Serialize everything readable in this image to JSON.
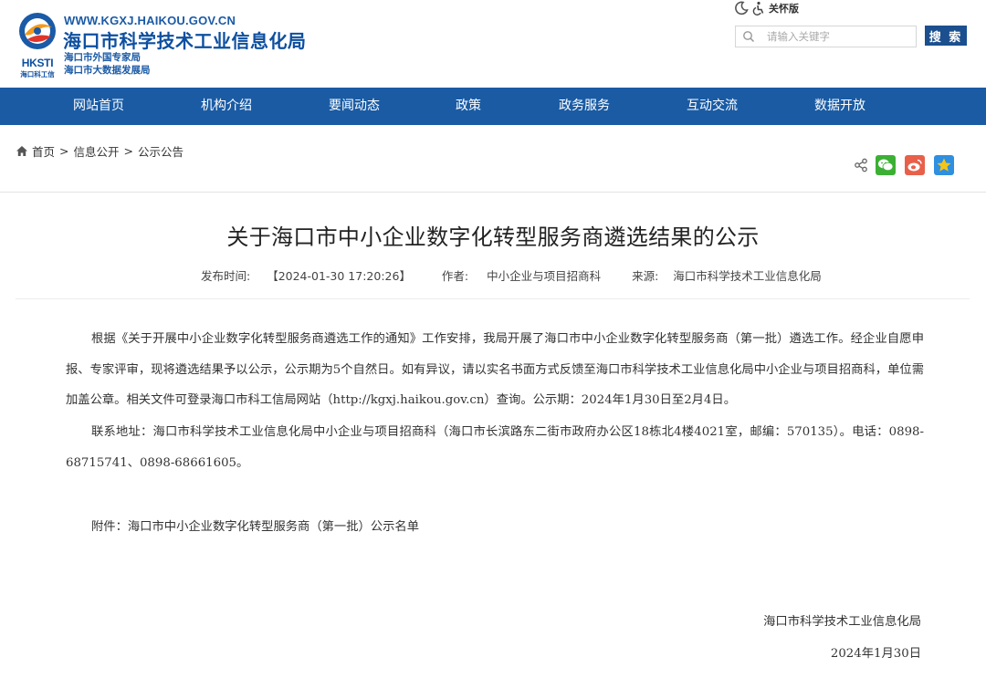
{
  "header": {
    "url": "WWW.KGXJ.HAIKOU.GOV.CN",
    "name": "海口市科学技术工业信息化局",
    "sub1": "海口市外国专家局",
    "sub2": "海口市大数据发展局",
    "logo_text": "HKSTI",
    "logo_sub": "海口科工信",
    "care_mode": "关怀版",
    "search_placeholder": "请输入关键字",
    "search_button": "搜 索"
  },
  "nav": {
    "items": [
      "网站首页",
      "机构介绍",
      "要闻动态",
      "政策",
      "政务服务",
      "互动交流",
      "数据开放"
    ]
  },
  "breadcrumb": {
    "items": [
      "首页",
      "信息公开",
      "公示公告"
    ],
    "separator": ">"
  },
  "article": {
    "title": "关于海口市中小企业数字化转型服务商遴选结果的公示",
    "meta": {
      "date_label": "发布时间:",
      "date_value": "【2024-01-30 17:20:26】",
      "author_label": "作者:",
      "author_value": "中小企业与项目招商科",
      "source_label": "来源:",
      "source_value": "海口市科学技术工业信息化局"
    },
    "p1": "根据《关于开展中小企业数字化转型服务商遴选工作的通知》工作安排，我局开展了海口市中小企业数字化转型服务商（第一批）遴选工作。经企业自愿申报、专家评审，现将遴选结果予以公示，公示期为5个自然日。如有异议，请以实名书面方式反馈至海口市科学技术工业信息化局中小企业与项目招商科，单位需加盖公章。相关文件可登录海口市科工信局网站（http://kgxj.haikou.gov.cn）查询。公示期：2024年1月30日至2月4日。",
    "p2": "联系地址：海口市科学技术工业信息化局中小企业与项目招商科（海口市长滨路东二街市政府办公区18栋北4楼4021室，邮编：570135）。电话：0898-68715741、0898-68661605。",
    "attachment": "附件：海口市中小企业数字化转型服务商（第一批）公示名单",
    "sign_org": "海口市科学技术工业信息化局",
    "sign_date": "2024年1月30日"
  },
  "colors": {
    "nav_bg": "#1a5ba4",
    "brand_blue": "#0d4fa0",
    "search_btn": "#1b4f8e",
    "wechat": "#3cb034",
    "weibo": "#e8604a",
    "qzone": "#2f8fe0"
  },
  "icons": {
    "logo": "logo-icon",
    "moon": "moon-icon",
    "accessibility": "accessibility-icon",
    "search": "search-icon",
    "home": "home-icon",
    "share": "share-icon",
    "wechat": "wechat-icon",
    "weibo": "weibo-icon",
    "qzone": "qzone-icon"
  }
}
